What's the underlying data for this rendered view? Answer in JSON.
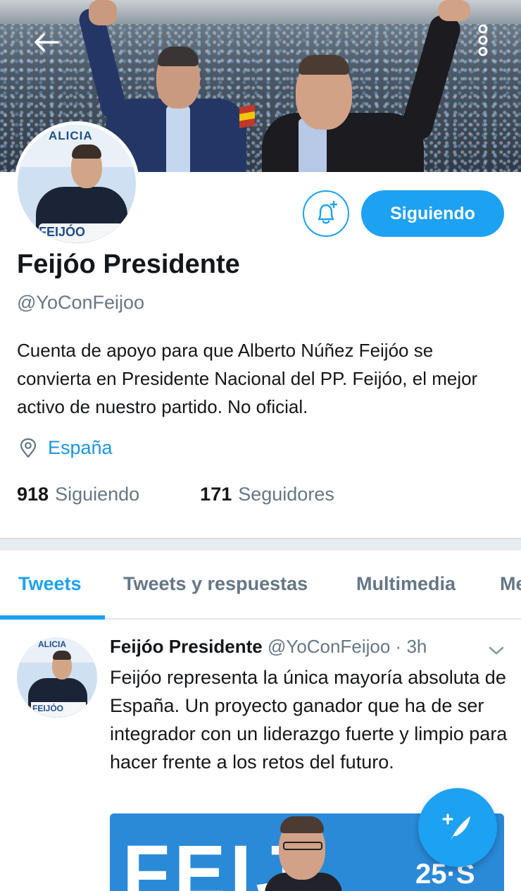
{
  "header": {
    "back_icon": "arrow-left-icon",
    "more_icon": "more-vertical-icon"
  },
  "banner": {
    "sign_text": "ALICIA",
    "podium_text": "FEIJÓO"
  },
  "profile": {
    "display_name": "Feijóo Presidente",
    "handle": "@YoConFeijoo",
    "bio": "Cuenta de apoyo para que Alberto Núñez Feijóo se convierta en Presidente Nacional del PP. Feijóo, el mejor activo de nuestro partido. No oficial.",
    "location": "España",
    "location_icon": "location-pin-icon",
    "notification_icon": "bell-plus-icon",
    "follow_button_label": "Siguiendo",
    "following_count": "918",
    "following_label": "Siguiendo",
    "followers_count": "171",
    "followers_label": "Seguidores"
  },
  "tabs": [
    {
      "label": "Tweets",
      "active": true
    },
    {
      "label": "Tweets y respuestas",
      "active": false
    },
    {
      "label": "Multimedia",
      "active": false
    },
    {
      "label": "Me",
      "active": false
    }
  ],
  "tweet": {
    "author_name": "Feijóo Presidente",
    "author_handle": "@YoConFeijoo",
    "separator": "·",
    "time": "3h",
    "text": "Feijóo representa la única mayoría absoluta de España. Un proyecto ganador que ha de ser integrador con un liderazgo fuerte y limpio para hacer frente a los retos del futuro.",
    "avatar_sign_text": "ALICIA",
    "avatar_podium_text": "FEIJÓO",
    "media_big_text": "FEIJ",
    "media_date_text": "25·S",
    "chevron_icon": "chevron-down-icon"
  },
  "fab": {
    "icon": "compose-tweet-icon"
  },
  "colors": {
    "accent": "#1da1f2",
    "link": "#1b95e0",
    "secondary_text": "#657786",
    "primary_text": "#14171a"
  }
}
